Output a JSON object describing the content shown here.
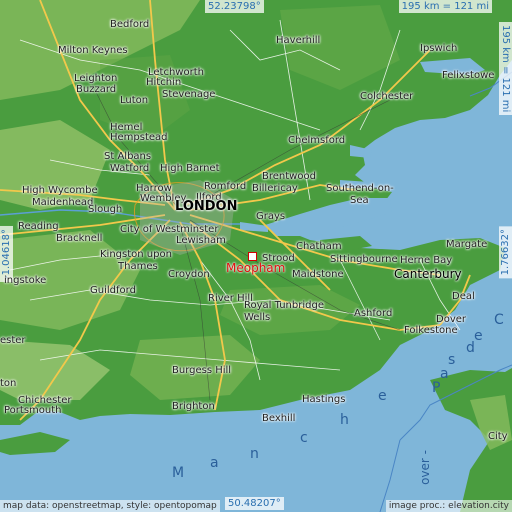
{
  "coords": {
    "top": "52.23798°",
    "bottom": "50.48207°",
    "left": "-1.04618°",
    "right": "1.76632°"
  },
  "scale": {
    "horizontal": "195 km = 121 mi",
    "vertical": "195 km = 121 mi"
  },
  "target_label": "Meopham",
  "places": {
    "london": "LONDON",
    "bedford": "Bedford",
    "haverhill": "Haverhill",
    "ipswich": "Ipswich",
    "milton_keynes": "Milton Keynes",
    "letchworth": "Letchworth",
    "felixstowe": "Felixstowe",
    "leighton_buzzard_1": "Leighton",
    "leighton_buzzard_2": "Buzzard",
    "hitchin": "Hitchin",
    "stevenage": "Stevenage",
    "colchester": "Colchester",
    "luton": "Luton",
    "hemel": "Hemel",
    "hempstead": "Hempstead",
    "st_albans": "St Albans",
    "chelmsford": "Chelmsford",
    "watford": "Watford",
    "high_barnet": "High Barnet",
    "brentwood": "Brentwood",
    "high_wycombe": "High Wycombe",
    "harrow": "Harrow",
    "romford": "Romford",
    "southend": "Southend-on-",
    "sea": "Sea",
    "maidenhead": "Maidenhead",
    "wembley": "Wembley",
    "ilford": "Ilford",
    "billericay": "Billericay",
    "slough": "Slough",
    "grays": "Grays",
    "reading": "Reading",
    "city_westminster": "City of Westminster",
    "bracknell": "Bracknell",
    "lewisham": "Lewisham",
    "chatham": "Chatham",
    "margate": "Margate",
    "kingston": "Kingston upon",
    "thames": "Thames",
    "rochester": "Strood",
    "sittingbourne": "Sittingbourne",
    "herne_bay": "Herne Bay",
    "croydon": "Croydon",
    "maidstone": "Maidstone",
    "canterbury": "Canterbury",
    "basingstoke": "ingstoke",
    "guildford": "Guildford",
    "deal": "Deal",
    "river_hill": "River Hill",
    "royal_tunbridge": "Royal Tunbridge",
    "wells": "Wells",
    "ashford": "Ashford",
    "dover": "Dover",
    "folkestone": "Folkestone",
    "ester": "ester",
    "burgess_hill": "Burgess Hill",
    "hastings": "Hastings",
    "bexhill": "Bexhill",
    "brighton": "Brighton",
    "chichester": "Chichester",
    "portsmouth": "Portsmouth",
    "ton": "ton",
    "city": "City"
  },
  "sea_labels": {
    "manche": [
      "M",
      "a",
      "n",
      "c",
      "h",
      "e"
    ],
    "pas_de_calais": [
      "P",
      "a",
      "s",
      " ",
      "d",
      "e",
      " ",
      "C"
    ],
    "dover_strait": "over -"
  },
  "attribution": {
    "left": "map data: openstreetmap, style: opentopomap",
    "right": "image proc.: elevation.city"
  },
  "colors": {
    "sea": "#7fb6d9",
    "land_low": "#3f9a3a",
    "land_high": "#93c470",
    "road_major": "#f2c84b",
    "road_minor": "#ffffff",
    "target": "#e01010",
    "coord_text": "#2a6fb0"
  }
}
